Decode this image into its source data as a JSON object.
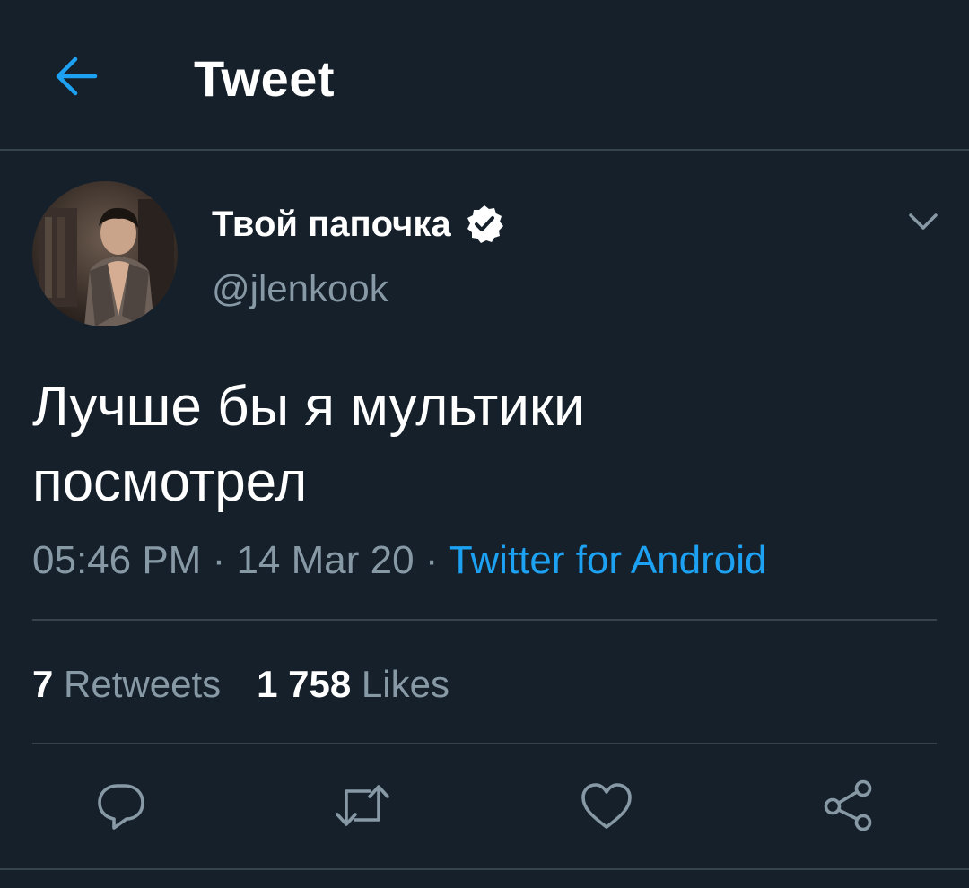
{
  "header": {
    "back_icon": "arrow-left-icon",
    "title": "Tweet"
  },
  "author": {
    "display_name": "Твой папочка",
    "handle": "@jlenkook",
    "verified": true
  },
  "tweet": {
    "text": "Лучше бы я мультики\nпосмотрел",
    "time": "05:46 PM",
    "separator": " · ",
    "date": "14 Mar 20",
    "source": "Twitter for Android"
  },
  "stats": {
    "retweets_count": "7",
    "retweets_label": "Retweets",
    "likes_count": "1 758",
    "likes_label": "Likes"
  },
  "actions": [
    "reply-icon",
    "retweet-icon",
    "like-icon",
    "share-icon"
  ],
  "colors": {
    "background": "#15202b",
    "accent": "#1da1f2",
    "secondary_text": "#8899a6",
    "divider": "#38444d"
  }
}
